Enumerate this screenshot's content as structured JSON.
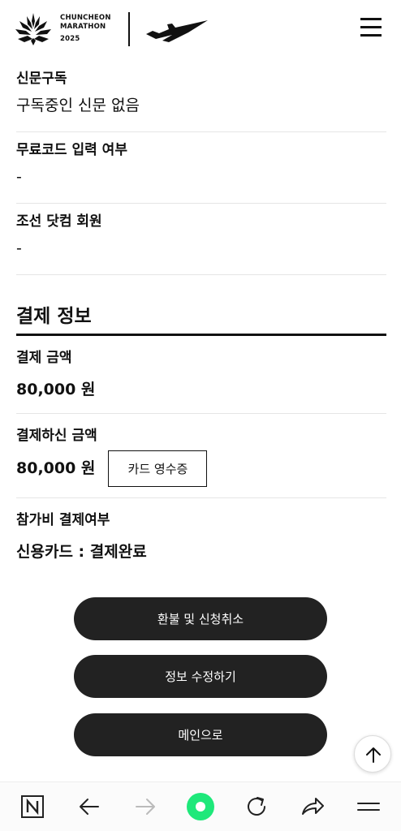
{
  "header": {
    "logo_line1": "CHUNCHEON",
    "logo_line2": "MARATHON",
    "logo_line3": "2025"
  },
  "fields": [
    {
      "label": "신문구독",
      "value": "구독중인 신문 없음"
    },
    {
      "label": "무료코드 입력 여부",
      "value": "-"
    },
    {
      "label": "조선 닷컴 회원",
      "value": "-"
    }
  ],
  "payment": {
    "section_title": "결제 정보",
    "amount_label": "결제 금액",
    "amount_value": "80,000 원",
    "paid_label": "결제하신 금액",
    "paid_value": "80,000 원",
    "receipt_button": "카드 영수증",
    "status_label": "참가비 결제여부",
    "status_value": "신용카드 : 결제완료"
  },
  "actions": {
    "refund": "환불 및 신청취소",
    "edit": "정보 수정하기",
    "main": "메인으로"
  },
  "colors": {
    "button_bg": "#222222",
    "accent_green": "#1ee87a"
  }
}
